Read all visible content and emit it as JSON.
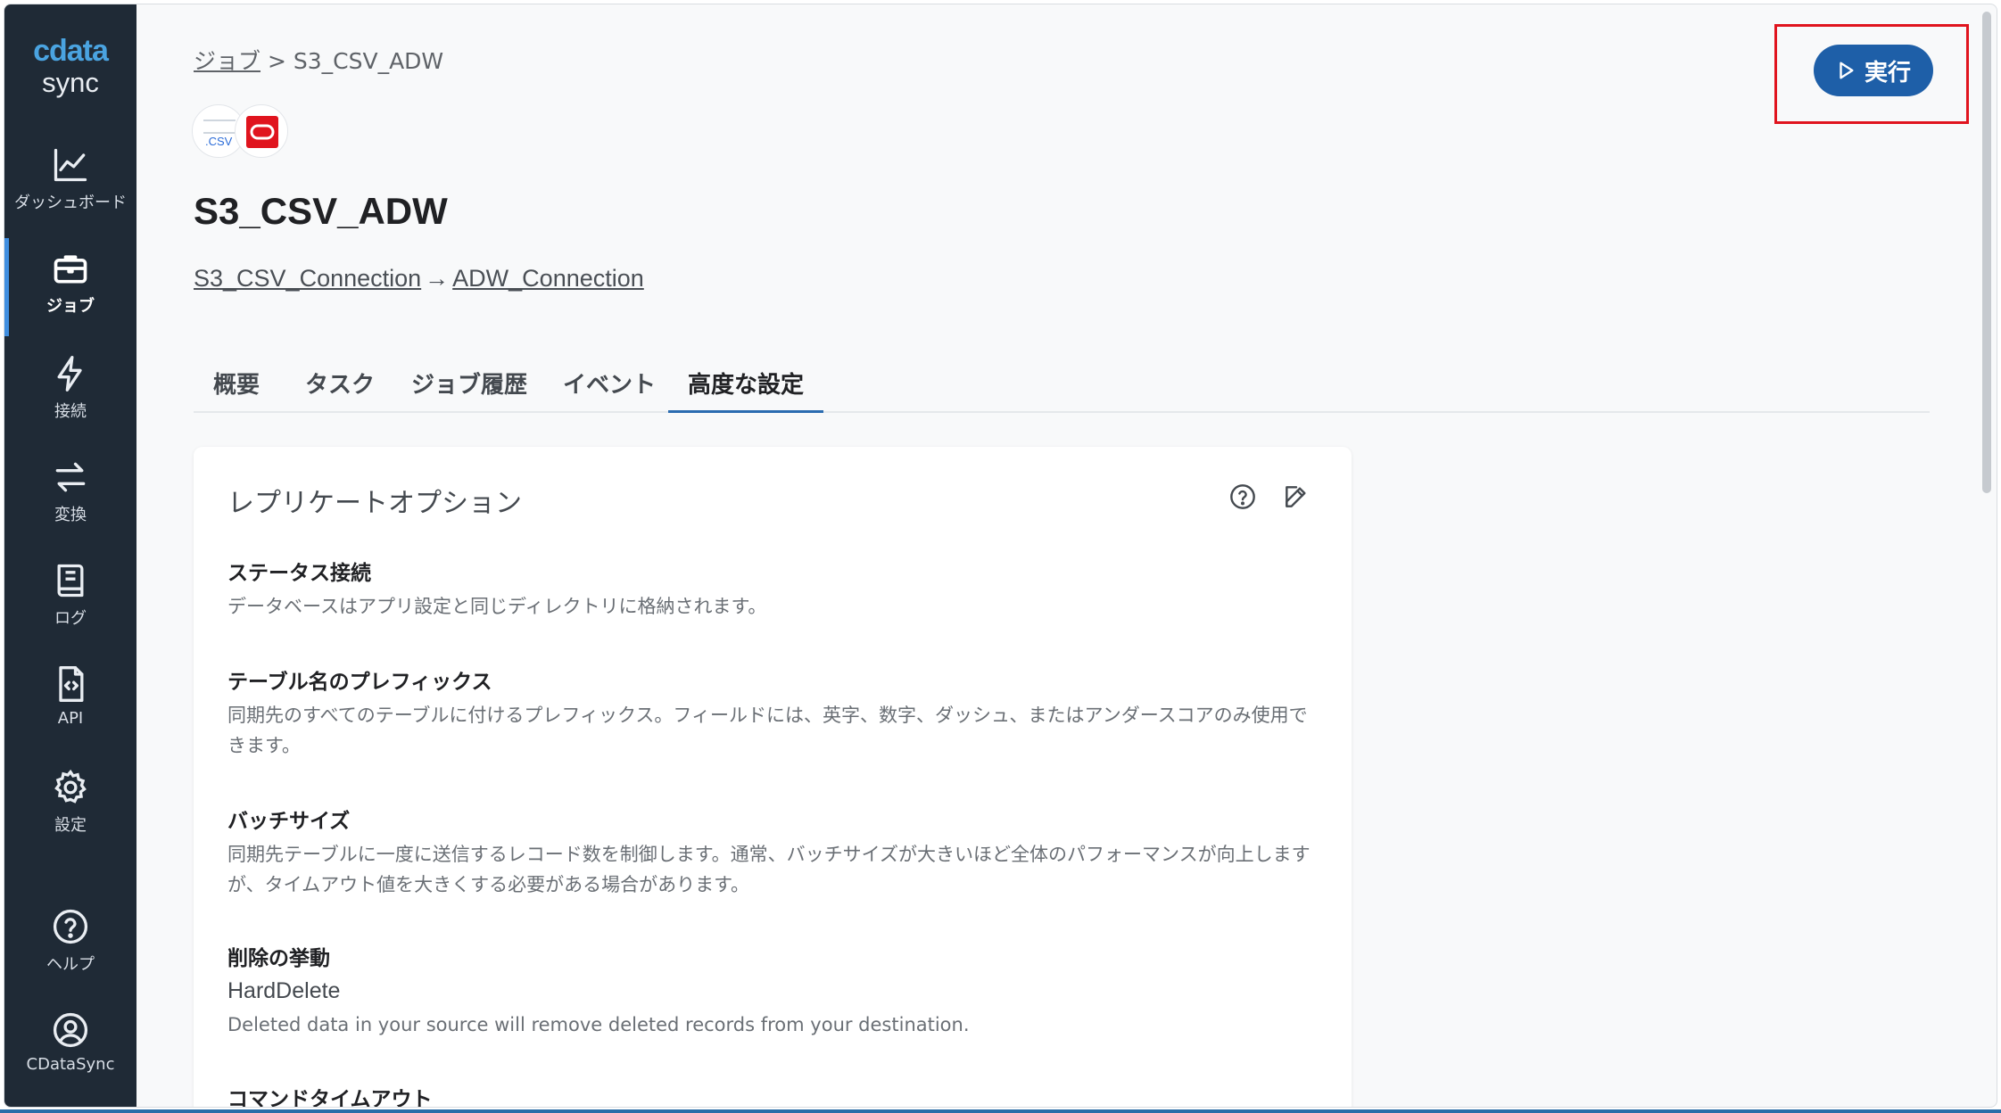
{
  "sidebar": {
    "logo_top": "cdata",
    "logo_bottom": "sync",
    "items": [
      {
        "label": "ダッシュボード",
        "icon": "dashboard-chart-icon"
      },
      {
        "label": "ジョブ",
        "icon": "briefcase-icon",
        "active": true
      },
      {
        "label": "接続",
        "icon": "lightning-icon"
      },
      {
        "label": "変換",
        "icon": "swap-arrows-icon"
      },
      {
        "label": "ログ",
        "icon": "book-icon"
      },
      {
        "label": "API",
        "icon": "code-file-icon"
      },
      {
        "label": "設定",
        "icon": "gear-icon"
      },
      {
        "label": "ヘルプ",
        "icon": "help-circle-icon"
      },
      {
        "label": "CDataSync",
        "icon": "user-circle-icon"
      }
    ]
  },
  "breadcrumb": {
    "parent": "ジョブ",
    "separator": ">",
    "current": "S3_CSV_ADW"
  },
  "job": {
    "title": "S3_CSV_ADW",
    "source_icon_text": ".CSV",
    "source": "S3_CSV_Connection",
    "arrow": "→",
    "destination": "ADW_Connection"
  },
  "tabs": [
    {
      "label": "概要"
    },
    {
      "label": "タスク"
    },
    {
      "label": "ジョブ履歴"
    },
    {
      "label": "イベント"
    },
    {
      "label": "高度な設定",
      "active": true
    }
  ],
  "run_button": {
    "label": "実行"
  },
  "card": {
    "title": "レプリケートオプション",
    "options": [
      {
        "label": "ステータス接続",
        "value": "",
        "desc": "データベースはアプリ設定と同じディレクトリに格納されます。"
      },
      {
        "label": "テーブル名のプレフィックス",
        "value": "",
        "desc": "同期先のすべてのテーブルに付けるプレフィックス。フィールドには、英字、数字、ダッシュ、またはアンダースコアのみ使用できます。"
      },
      {
        "label": "バッチサイズ",
        "value": "",
        "desc": "同期先テーブルに一度に送信するレコード数を制御します。通常、バッチサイズが大きいほど全体のパフォーマンスが向上しますが、タイムアウト値を大きくする必要がある場合があります。"
      },
      {
        "label": "削除の挙動",
        "value": "HardDelete",
        "desc": "Deleted data in your source will remove deleted records from your destination."
      },
      {
        "label": "コマンドタイムアウト",
        "value": "",
        "desc": ""
      }
    ]
  },
  "colors": {
    "sidebar_bg": "#1f2a36",
    "accent": "#1e5fa8",
    "highlight": "#e0141e",
    "oracle_red": "#e0141e"
  }
}
